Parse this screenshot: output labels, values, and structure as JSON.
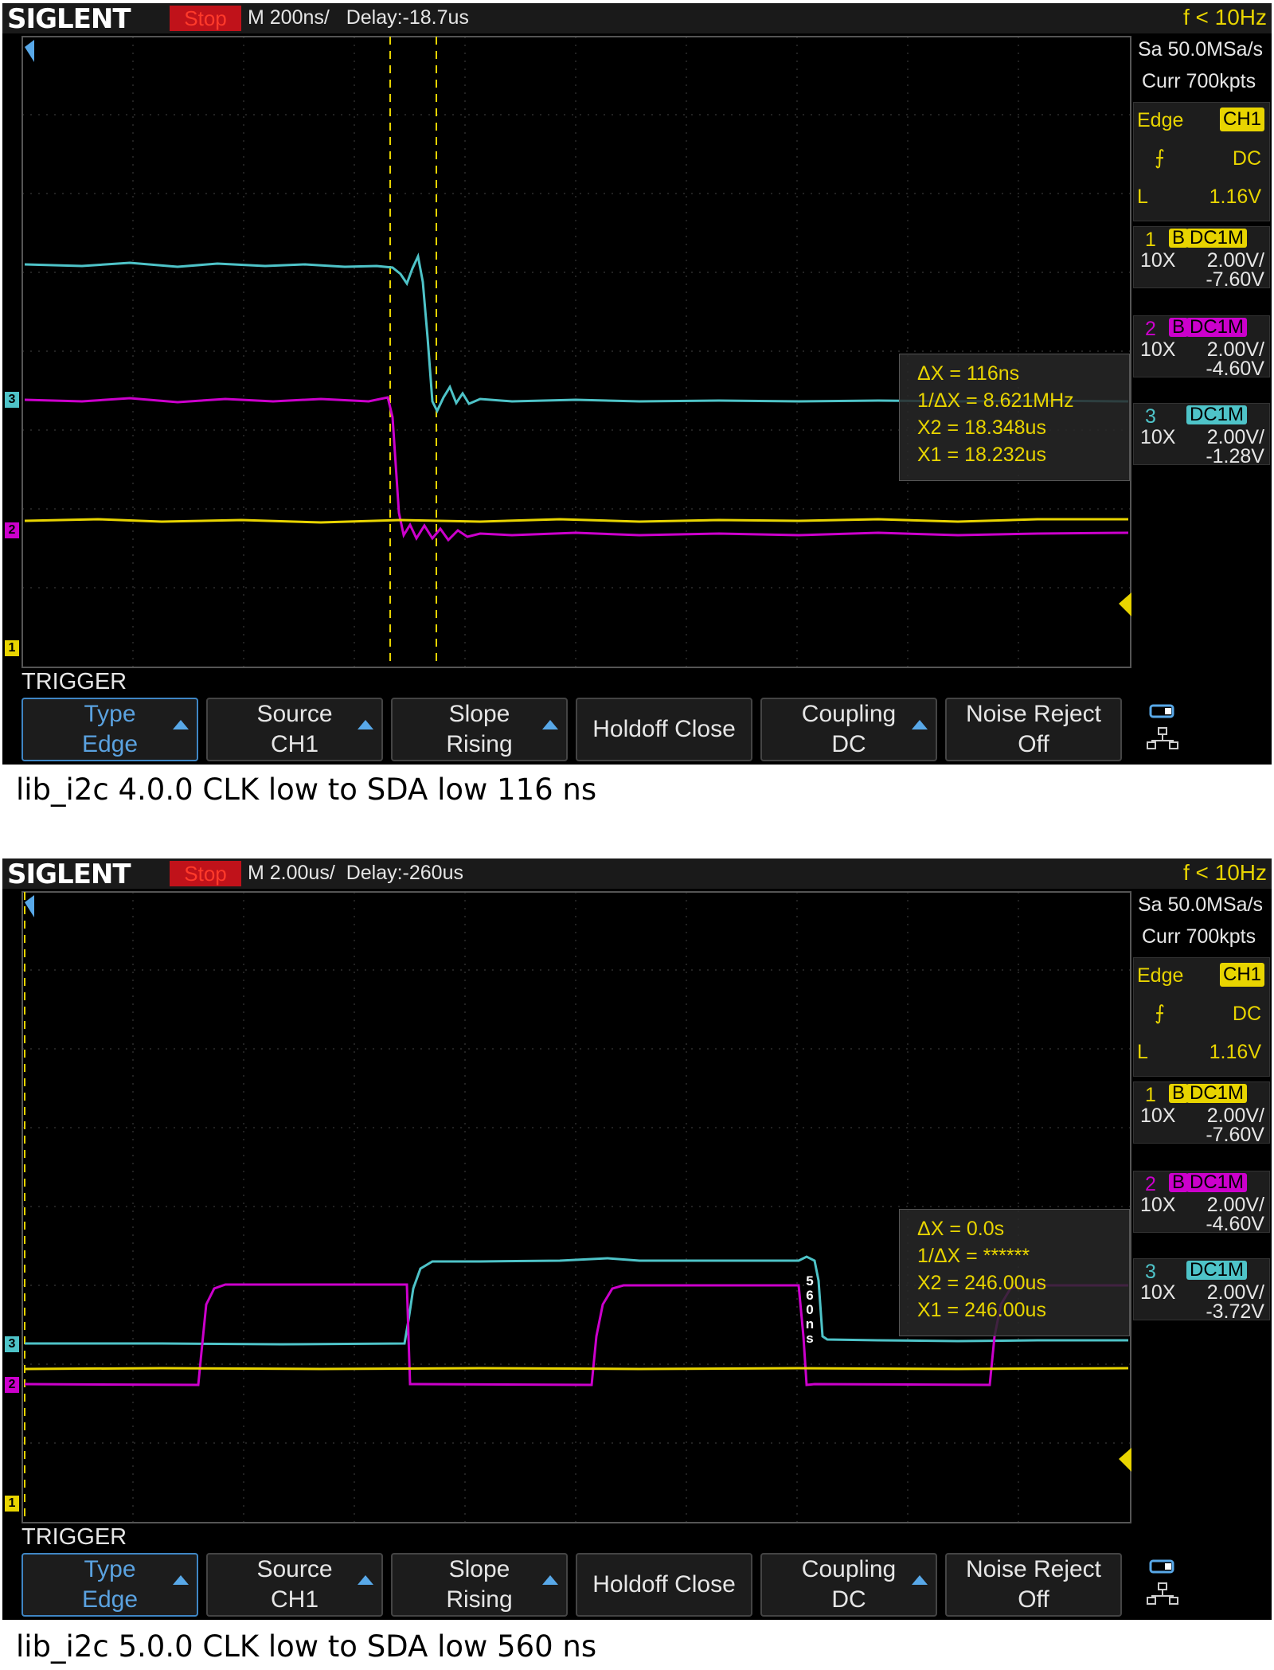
{
  "colors": {
    "ch1": "#e8d400",
    "ch2": "#cc00cc",
    "ch3": "#4ec3c8",
    "accent": "#3f86c4",
    "stop": "#c0121a"
  },
  "screens": [
    {
      "logo": "SIGLENT",
      "status": "Stop",
      "timebase": "M 200ns/",
      "delay": "Delay:-18.7us",
      "freq": "f < 10Hz",
      "sample_rate": "Sa 50.0MSa/s",
      "curr": "Curr 700kpts",
      "trig_type": "Edge",
      "trig_source": "CH1",
      "trig_coupling": "DC",
      "trig_level_label": "L",
      "trig_level": "1.16V",
      "channels": [
        {
          "num": "1",
          "bw": "B",
          "coupling": "DC1M",
          "probe": "10X",
          "scale": "2.00V/",
          "offset": "-7.60V"
        },
        {
          "num": "2",
          "bw": "B",
          "coupling": "DC1M",
          "probe": "10X",
          "scale": "2.00V/",
          "offset": "-4.60V"
        },
        {
          "num": "3",
          "bw": "",
          "coupling": "DC1M",
          "probe": "10X",
          "scale": "2.00V/",
          "offset": "-1.28V"
        }
      ],
      "measure": {
        "dx": "ΔX = 116ns",
        "inv": "1/ΔX = 8.621MHz",
        "x2": "X2 = 18.348us",
        "x1": "X1 = 18.232us"
      },
      "trigger_label": "TRIGGER",
      "softkeys": [
        {
          "l1": "Type",
          "l2": "Edge"
        },
        {
          "l1": "Source",
          "l2": "CH1"
        },
        {
          "l1": "Slope",
          "l2": "Rising"
        },
        {
          "single": "Holdoff Close"
        },
        {
          "l1": "Coupling",
          "l2": "DC"
        },
        {
          "l1": "Noise Reject",
          "l2": "Off"
        }
      ],
      "caption": "lib_i2c 4.0.0 CLK low to SDA low 116 ns"
    },
    {
      "logo": "SIGLENT",
      "status": "Stop",
      "timebase": "M 2.00us/",
      "delay": "Delay:-260us",
      "freq": "f < 10Hz",
      "sample_rate": "Sa 50.0MSa/s",
      "curr": "Curr 700kpts",
      "trig_type": "Edge",
      "trig_source": "CH1",
      "trig_coupling": "DC",
      "trig_level_label": "L",
      "trig_level": "1.16V",
      "channels": [
        {
          "num": "1",
          "bw": "B",
          "coupling": "DC1M",
          "probe": "10X",
          "scale": "2.00V/",
          "offset": "-7.60V"
        },
        {
          "num": "2",
          "bw": "B",
          "coupling": "DC1M",
          "probe": "10X",
          "scale": "2.00V/",
          "offset": "-4.60V"
        },
        {
          "num": "3",
          "bw": "",
          "coupling": "DC1M",
          "probe": "10X",
          "scale": "2.00V/",
          "offset": "-3.72V"
        }
      ],
      "measure": {
        "dx": "ΔX = 0.0s",
        "inv": "1/ΔX = ******",
        "x2": "X2 = 246.00us",
        "x1": "X1 = 246.00us"
      },
      "annotation": "560ns",
      "trigger_label": "TRIGGER",
      "softkeys": [
        {
          "l1": "Type",
          "l2": "Edge"
        },
        {
          "l1": "Source",
          "l2": "CH1"
        },
        {
          "l1": "Slope",
          "l2": "Rising"
        },
        {
          "single": "Holdoff Close"
        },
        {
          "l1": "Coupling",
          "l2": "DC"
        },
        {
          "l1": "Noise Reject",
          "l2": "Off"
        }
      ],
      "caption": "lib_i2c 5.0.0 CLK low to SDA low 560 ns"
    }
  ]
}
